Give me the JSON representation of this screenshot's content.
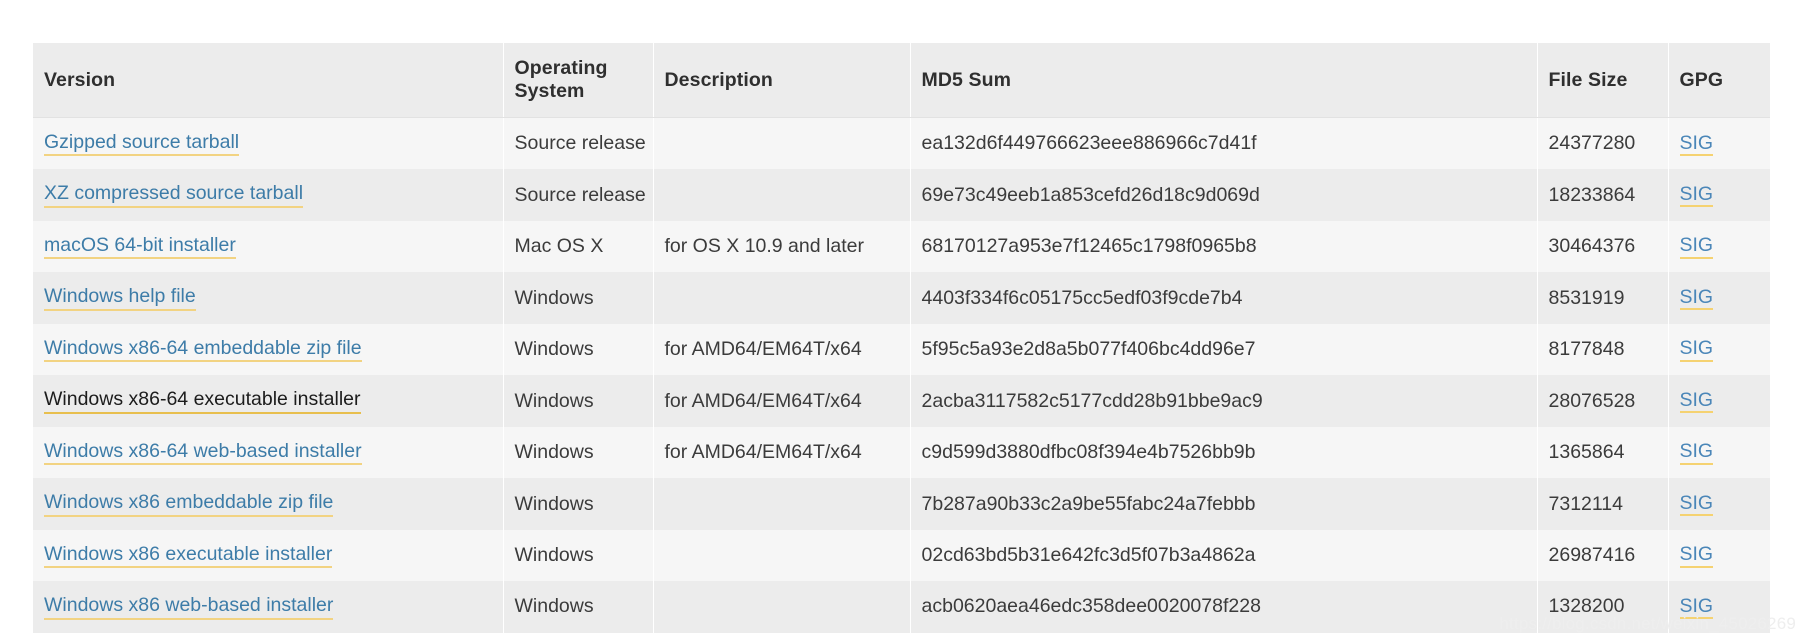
{
  "table": {
    "columns": [
      {
        "key": "version",
        "label": "Version"
      },
      {
        "key": "os",
        "label": "Operating System"
      },
      {
        "key": "description",
        "label": "Description"
      },
      {
        "key": "md5",
        "label": "MD5 Sum"
      },
      {
        "key": "filesize",
        "label": "File Size"
      },
      {
        "key": "gpg",
        "label": "GPG"
      }
    ],
    "rows": [
      {
        "version": "Gzipped source tarball",
        "os": "Source release",
        "description": "",
        "md5": "ea132d6f449766623eee886966c7d41f",
        "filesize": "24377280",
        "gpg": "SIG",
        "hover": false
      },
      {
        "version": "XZ compressed source tarball",
        "os": "Source release",
        "description": "",
        "md5": "69e73c49eeb1a853cefd26d18c9d069d",
        "filesize": "18233864",
        "gpg": "SIG",
        "hover": false
      },
      {
        "version": "macOS 64-bit installer",
        "os": "Mac OS X",
        "description": "for OS X 10.9 and later",
        "md5": "68170127a953e7f12465c1798f0965b8",
        "filesize": "30464376",
        "gpg": "SIG",
        "hover": false
      },
      {
        "version": "Windows help file",
        "os": "Windows",
        "description": "",
        "md5": "4403f334f6c05175cc5edf03f9cde7b4",
        "filesize": "8531919",
        "gpg": "SIG",
        "hover": false
      },
      {
        "version": "Windows x86-64 embeddable zip file",
        "os": "Windows",
        "description": "for AMD64/EM64T/x64",
        "md5": "5f95c5a93e2d8a5b077f406bc4dd96e7",
        "filesize": "8177848",
        "gpg": "SIG",
        "hover": false
      },
      {
        "version": "Windows x86-64 executable installer",
        "os": "Windows",
        "description": "for AMD64/EM64T/x64",
        "md5": "2acba3117582c5177cdd28b91bbe9ac9",
        "filesize": "28076528",
        "gpg": "SIG",
        "hover": true
      },
      {
        "version": "Windows x86-64 web-based installer",
        "os": "Windows",
        "description": "for AMD64/EM64T/x64",
        "md5": "c9d599d3880dfbc08f394e4b7526bb9b",
        "filesize": "1365864",
        "gpg": "SIG",
        "hover": false
      },
      {
        "version": "Windows x86 embeddable zip file",
        "os": "Windows",
        "description": "",
        "md5": "7b287a90b33c2a9be55fabc24a7febbb",
        "filesize": "7312114",
        "gpg": "SIG",
        "hover": false
      },
      {
        "version": "Windows x86 executable installer",
        "os": "Windows",
        "description": "",
        "md5": "02cd63bd5b31e642fc3d5f07b3a4862a",
        "filesize": "26987416",
        "gpg": "SIG",
        "hover": false
      },
      {
        "version": "Windows x86 web-based installer",
        "os": "Windows",
        "description": "",
        "md5": "acb0620aea46edc358dee0020078f228",
        "filesize": "1328200",
        "gpg": "SIG",
        "hover": false
      }
    ]
  },
  "watermark": {
    "text": "https://blog.csdn.net/weixin_45026269"
  },
  "colors": {
    "link": "#3d7ca8",
    "link_underline": "#f2d382",
    "header_bg": "#ececec",
    "row_odd_bg": "#f6f6f6",
    "row_even_bg": "#ececec"
  }
}
